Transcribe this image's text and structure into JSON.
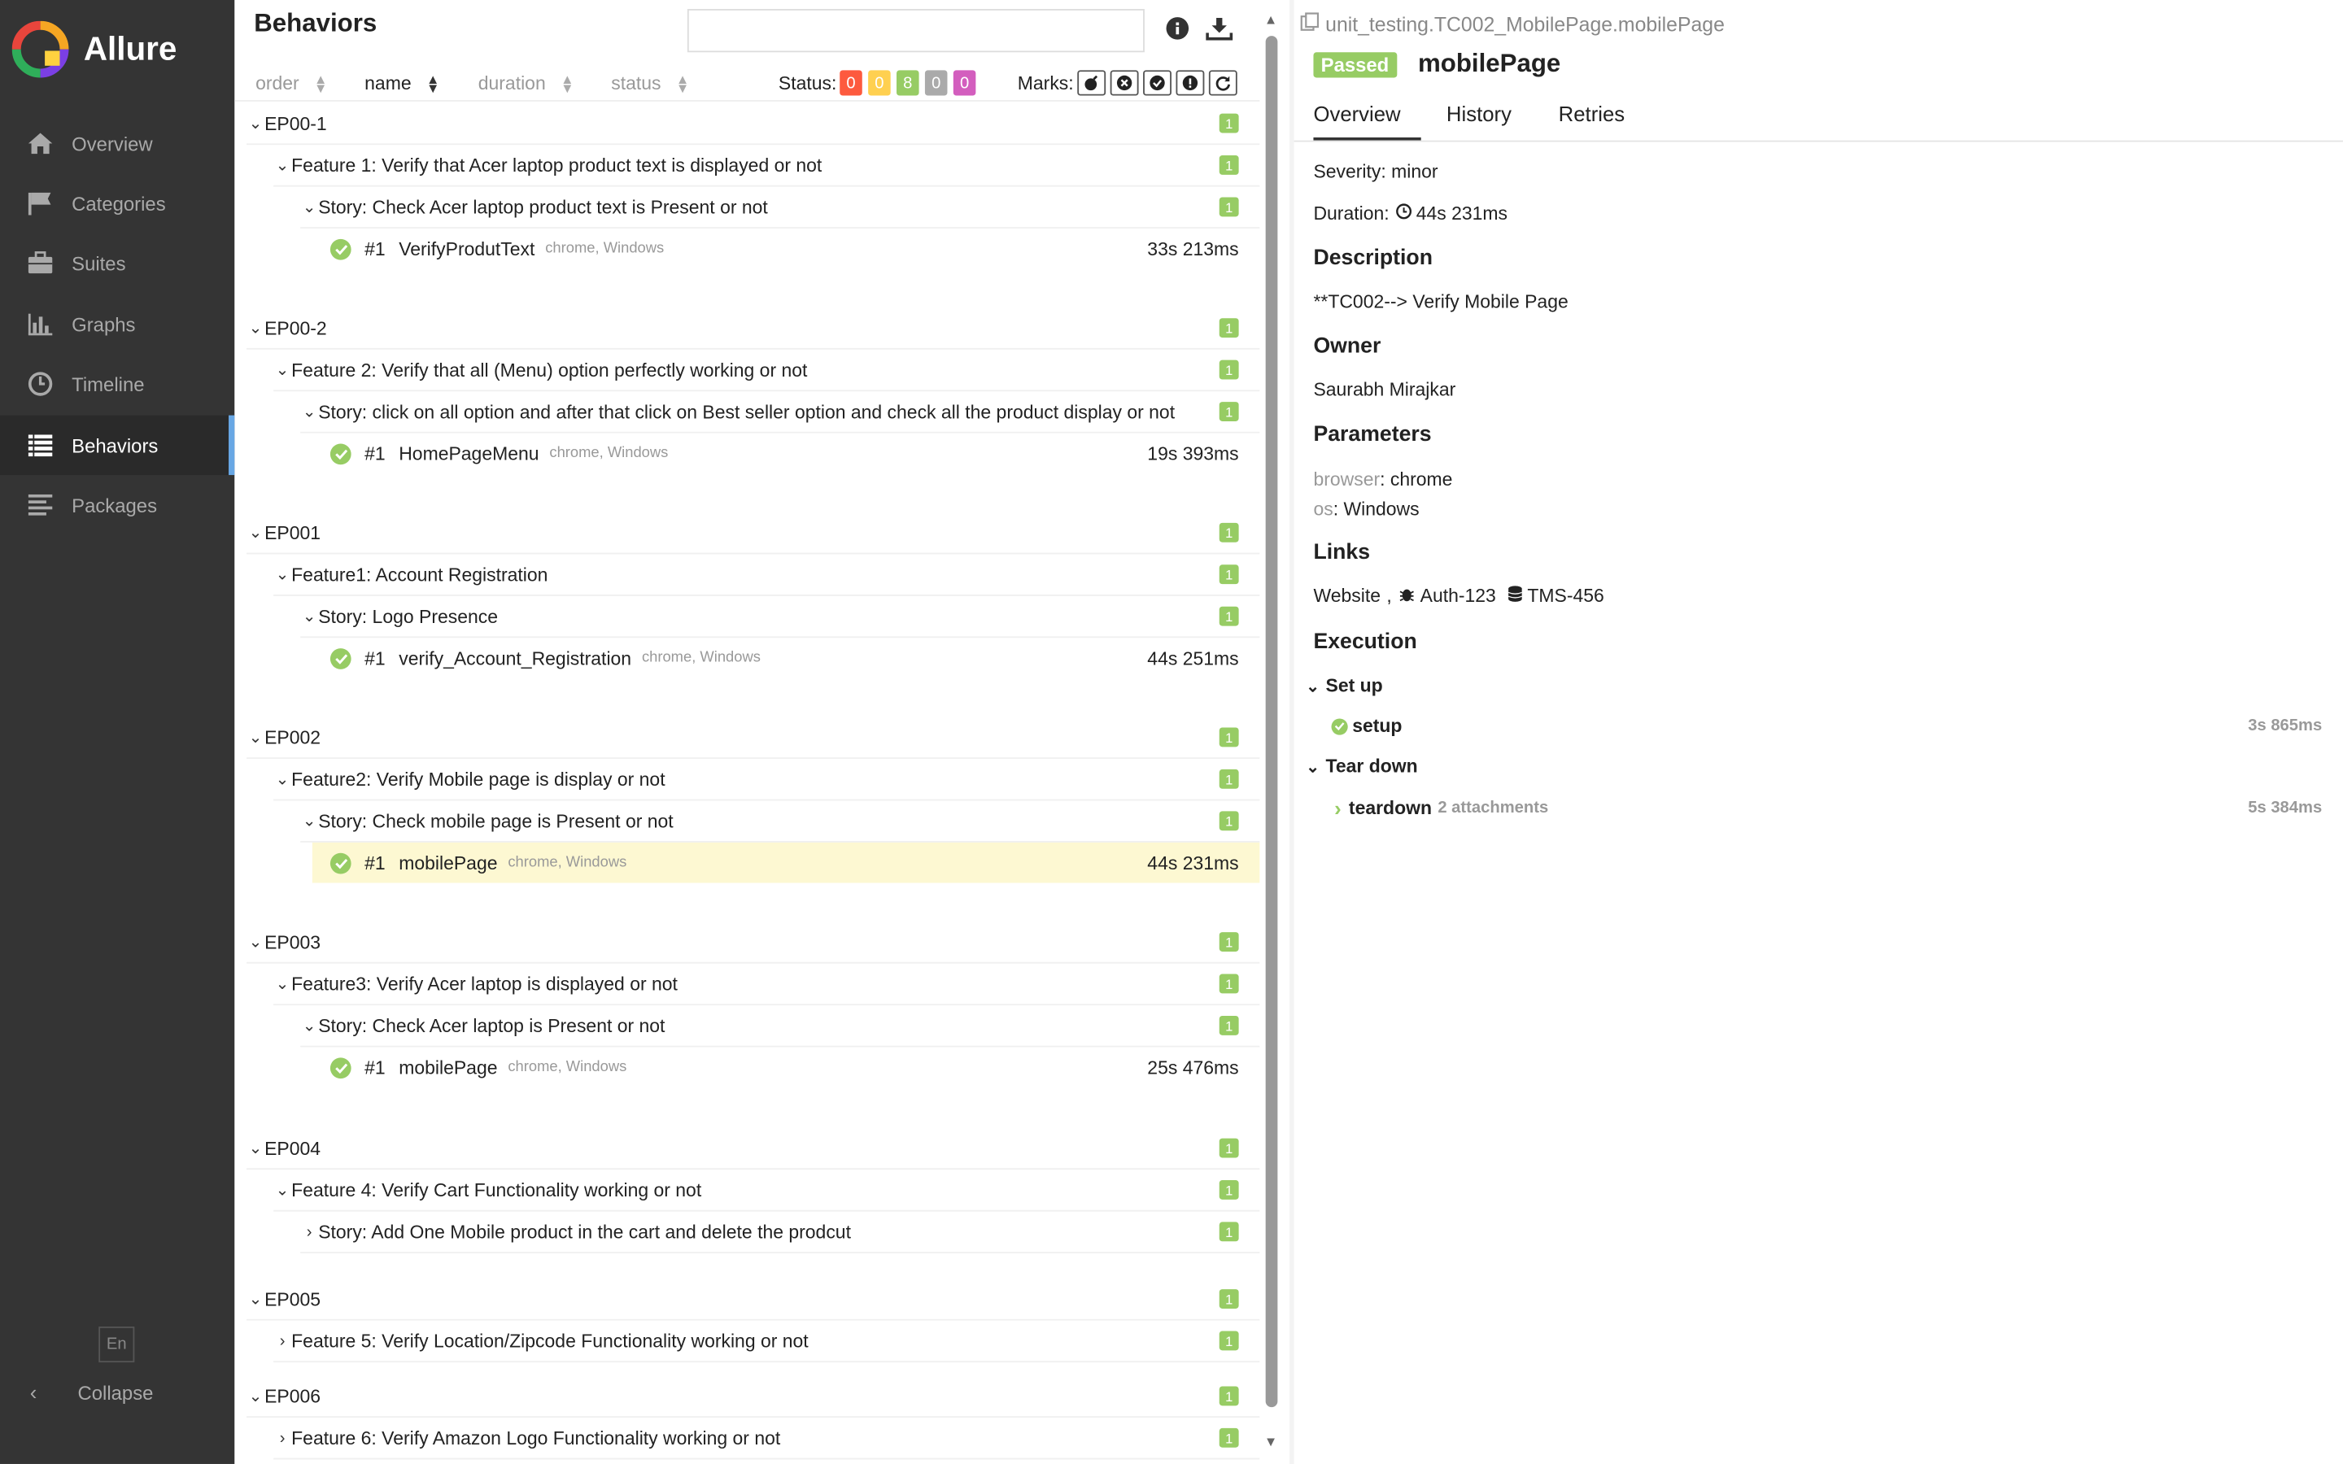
{
  "app": {
    "name": "Allure"
  },
  "sidebar": {
    "items": [
      {
        "label": "Overview",
        "icon": "home-icon"
      },
      {
        "label": "Categories",
        "icon": "flag-icon"
      },
      {
        "label": "Suites",
        "icon": "briefcase-icon"
      },
      {
        "label": "Graphs",
        "icon": "bar-chart-icon"
      },
      {
        "label": "Timeline",
        "icon": "clock-icon"
      },
      {
        "label": "Behaviors",
        "icon": "list-icon",
        "active": true
      },
      {
        "label": "Packages",
        "icon": "align-left-icon"
      }
    ],
    "lang": "En",
    "collapse": "Collapse"
  },
  "behaviors": {
    "title": "Behaviors",
    "search_value": "",
    "sort": {
      "order": "order",
      "name": "name",
      "duration": "duration",
      "status": "status"
    },
    "status_label": "Status:",
    "status_counts": [
      {
        "value": "0",
        "color": "#fd5a3e"
      },
      {
        "value": "0",
        "color": "#ffd050"
      },
      {
        "value": "8",
        "color": "#97cc64"
      },
      {
        "value": "0",
        "color": "#aaaaaa"
      },
      {
        "value": "0",
        "color": "#d35ebe"
      }
    ],
    "marks_label": "Marks:",
    "epics": [
      {
        "name": "EP00-1",
        "count": "1",
        "feature": {
          "name": "Feature 1: Verify that Acer laptop product text is displayed or not",
          "count": "1"
        },
        "story": {
          "name": "Story: Check Acer laptop product text is Present or not",
          "count": "1"
        },
        "test": {
          "num": "#1",
          "name": "VerifyProdutText",
          "params": "chrome, Windows",
          "duration": "33s 213ms"
        }
      },
      {
        "name": "EP00-2",
        "count": "1",
        "feature": {
          "name": "Feature 2: Verify that all (Menu) option perfectly working or not",
          "count": "1"
        },
        "story": {
          "name": "Story: click on all option and after that click on Best seller option and check all the product display or not",
          "count": "1"
        },
        "test": {
          "num": "#1",
          "name": "HomePageMenu",
          "params": "chrome, Windows",
          "duration": "19s 393ms"
        }
      },
      {
        "name": "EP001",
        "count": "1",
        "feature": {
          "name": "Feature1: Account Registration",
          "count": "1"
        },
        "story": {
          "name": "Story: Logo Presence",
          "count": "1"
        },
        "test": {
          "num": "#1",
          "name": "verify_Account_Registration",
          "params": "chrome, Windows",
          "duration": "44s 251ms"
        }
      },
      {
        "name": "EP002",
        "count": "1",
        "feature": {
          "name": "Feature2: Verify Mobile page is display or not",
          "count": "1"
        },
        "story": {
          "name": "Story: Check mobile page is Present or not",
          "count": "1"
        },
        "test": {
          "num": "#1",
          "name": "mobilePage",
          "params": "chrome, Windows",
          "duration": "44s 231ms"
        }
      },
      {
        "name": "EP003",
        "count": "1",
        "feature": {
          "name": "Feature3: Verify Acer laptop is displayed or not",
          "count": "1"
        },
        "story": {
          "name": "Story: Check Acer laptop is Present or not",
          "count": "1"
        },
        "test": {
          "num": "#1",
          "name": "mobilePage",
          "params": "chrome, Windows",
          "duration": "25s 476ms"
        }
      },
      {
        "name": "EP004",
        "count": "1",
        "feature": {
          "name": "Feature 4: Verify Cart Functionality working or not",
          "count": "1"
        },
        "story": {
          "name": "Story: Add One Mobile product in the cart and delete the prodcut",
          "count": "1"
        }
      },
      {
        "name": "EP005",
        "count": "1",
        "feature": {
          "name": "Feature 5: Verify Location/Zipcode Functionality working or not",
          "count": "1"
        }
      },
      {
        "name": "EP006",
        "count": "1",
        "feature": {
          "name": "Feature 6: Verify Amazon Logo Functionality working or not",
          "count": "1"
        }
      }
    ]
  },
  "detail": {
    "path": "unit_testing.TC002_MobilePage.mobilePage",
    "status": "Passed",
    "title": "mobilePage",
    "tabs": [
      "Overview",
      "History",
      "Retries"
    ],
    "severity": "Severity: minor",
    "duration_label": "Duration:",
    "duration": "44s 231ms",
    "description_heading": "Description",
    "description": "**TC002--> Verify Mobile Page",
    "owner_heading": "Owner",
    "owner": "Saurabh Mirajkar",
    "parameters_heading": "Parameters",
    "params": [
      {
        "key": "browser",
        "value": ": chrome"
      },
      {
        "key": "os",
        "value": ": Windows"
      }
    ],
    "links_heading": "Links",
    "links": {
      "website": "Website",
      "sep": ",",
      "issue": "Auth-123",
      "tms": "TMS-456"
    },
    "execution_heading": "Execution",
    "setup_label": "Set up",
    "setup_step": {
      "name": "setup",
      "duration": "3s 865ms"
    },
    "teardown_label": "Tear down",
    "teardown_step": {
      "name": "teardown",
      "attachments": "2 attachments",
      "duration": "5s 384ms"
    }
  }
}
